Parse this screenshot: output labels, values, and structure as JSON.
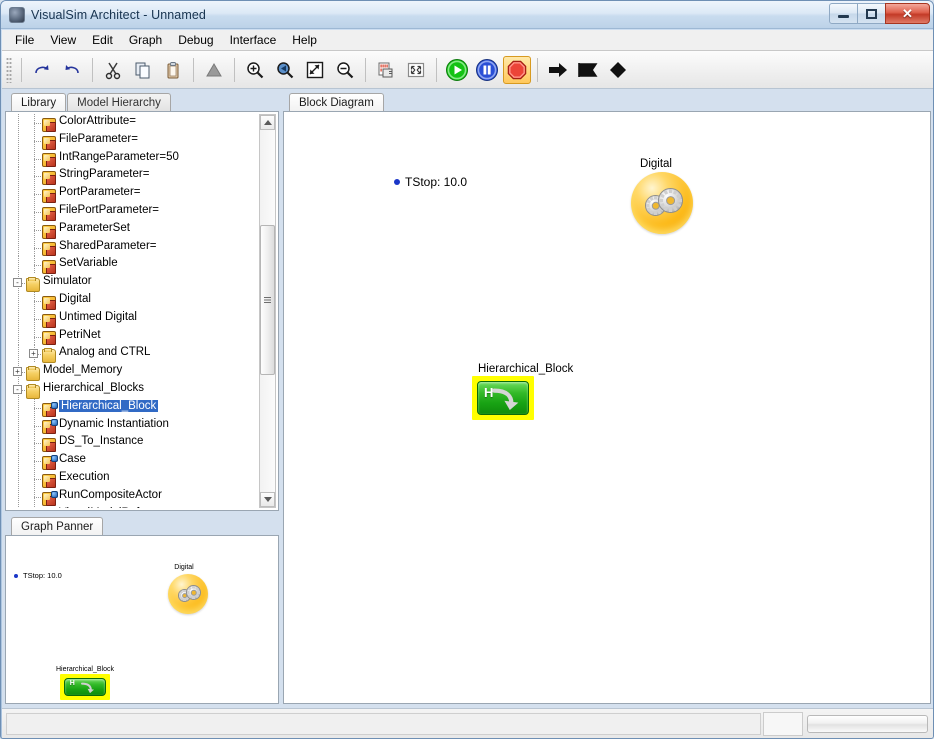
{
  "window": {
    "title": "VisualSim Architect - Unnamed",
    "app_icon": "app-icon",
    "buttons": {
      "minimize": "minimize",
      "maximize": "maximize",
      "close": "✕"
    }
  },
  "menubar": {
    "items": [
      "File",
      "View",
      "Edit",
      "Graph",
      "Debug",
      "Interface",
      "Help"
    ]
  },
  "toolbar": {
    "groups": [
      [
        {
          "name": "redo-icon",
          "glyph": "redo"
        },
        {
          "name": "undo-icon",
          "glyph": "undo"
        }
      ],
      [
        {
          "name": "cut-icon",
          "glyph": "scissors"
        },
        {
          "name": "copy-icon",
          "glyph": "copy"
        },
        {
          "name": "paste-icon",
          "glyph": "clipboard"
        }
      ],
      [
        {
          "name": "triangle-icon",
          "glyph": "triangle"
        }
      ],
      [
        {
          "name": "zoom-in-icon",
          "glyph": "zoom-in"
        },
        {
          "name": "zoom-back-icon",
          "glyph": "zoom-back"
        },
        {
          "name": "zoom-fit-icon",
          "glyph": "zoom-fit"
        },
        {
          "name": "zoom-out-icon",
          "glyph": "zoom-out"
        }
      ],
      [
        {
          "name": "code-view-icon",
          "glyph": "code"
        },
        {
          "name": "full-screen-icon",
          "glyph": "fullscreen"
        }
      ],
      [
        {
          "name": "run-icon",
          "glyph": "play"
        },
        {
          "name": "pause-icon",
          "glyph": "pause"
        },
        {
          "name": "stop-icon",
          "glyph": "stop",
          "active": true
        }
      ],
      [
        {
          "name": "arrow-right-icon",
          "glyph": "arrow"
        },
        {
          "name": "flag-icon",
          "glyph": "flag"
        },
        {
          "name": "diamond-icon",
          "glyph": "diamond"
        }
      ]
    ]
  },
  "library": {
    "tabs": [
      {
        "label": "Library",
        "active": true
      },
      {
        "label": "Model Hierarchy",
        "active": false
      }
    ],
    "tree": [
      {
        "label": "ColorAttribute=",
        "depth": 3,
        "icon": "actor",
        "expander": null
      },
      {
        "label": "FileParameter=",
        "depth": 3,
        "icon": "actor",
        "expander": null
      },
      {
        "label": "IntRangeParameter=50",
        "depth": 3,
        "icon": "actor",
        "expander": null
      },
      {
        "label": "StringParameter=",
        "depth": 3,
        "icon": "actor",
        "expander": null
      },
      {
        "label": "PortParameter=",
        "depth": 3,
        "icon": "actor",
        "expander": null
      },
      {
        "label": "FilePortParameter=",
        "depth": 3,
        "icon": "actor",
        "expander": null
      },
      {
        "label": "ParameterSet",
        "depth": 3,
        "icon": "actor",
        "expander": null
      },
      {
        "label": "SharedParameter=",
        "depth": 3,
        "icon": "actor",
        "expander": null
      },
      {
        "label": "SetVariable",
        "depth": 3,
        "icon": "actor",
        "expander": null
      },
      {
        "label": "Simulator",
        "depth": 2,
        "icon": "folder",
        "expander": "-"
      },
      {
        "label": "Digital",
        "depth": 3,
        "icon": "actor",
        "expander": null
      },
      {
        "label": "Untimed Digital",
        "depth": 3,
        "icon": "actor",
        "expander": null
      },
      {
        "label": "PetriNet",
        "depth": 3,
        "icon": "actor",
        "expander": null
      },
      {
        "label": "Analog and CTRL",
        "depth": 3,
        "icon": "folder",
        "expander": "+"
      },
      {
        "label": "Model_Memory",
        "depth": 2,
        "icon": "folder",
        "expander": "+"
      },
      {
        "label": "Hierarchical_Blocks",
        "depth": 2,
        "icon": "folder",
        "expander": "-"
      },
      {
        "label": "Hierarchical_Block",
        "depth": 3,
        "icon": "actor-blue",
        "expander": null,
        "selected": true
      },
      {
        "label": "Dynamic Instantiation",
        "depth": 3,
        "icon": "actor-blue",
        "expander": null
      },
      {
        "label": "DS_To_Instance",
        "depth": 3,
        "icon": "actor",
        "expander": null
      },
      {
        "label": "Case",
        "depth": 3,
        "icon": "actor-blue",
        "expander": null
      },
      {
        "label": "Execution",
        "depth": 3,
        "icon": "actor",
        "expander": null
      },
      {
        "label": "RunCompositeActor",
        "depth": 3,
        "icon": "actor-blue",
        "expander": null
      },
      {
        "label": "VisualModelReference",
        "depth": 3,
        "icon": "actor",
        "expander": null
      }
    ],
    "selection_color": "#316ac5"
  },
  "panner": {
    "tabs": [
      {
        "label": "Graph Panner",
        "active": true
      }
    ],
    "nodes": {
      "tstop": "TStop: 10.0",
      "digital_label": "Digital",
      "hblock_label": "Hierarchical_Block"
    }
  },
  "canvas": {
    "tabs": [
      {
        "label": "Block Diagram",
        "active": true
      }
    ],
    "nodes": {
      "tstop": "TStop: 10.0",
      "digital_label": "Digital",
      "hblock_label": "Hierarchical_Block",
      "hblock_letter": "H"
    },
    "colors": {
      "selection_highlight": "#ffff00",
      "block_green": "#19a314",
      "digital_orange": "#fcb918",
      "tstop_dot": "#1a36c8"
    }
  },
  "statusbar": {
    "progress_value": ""
  }
}
